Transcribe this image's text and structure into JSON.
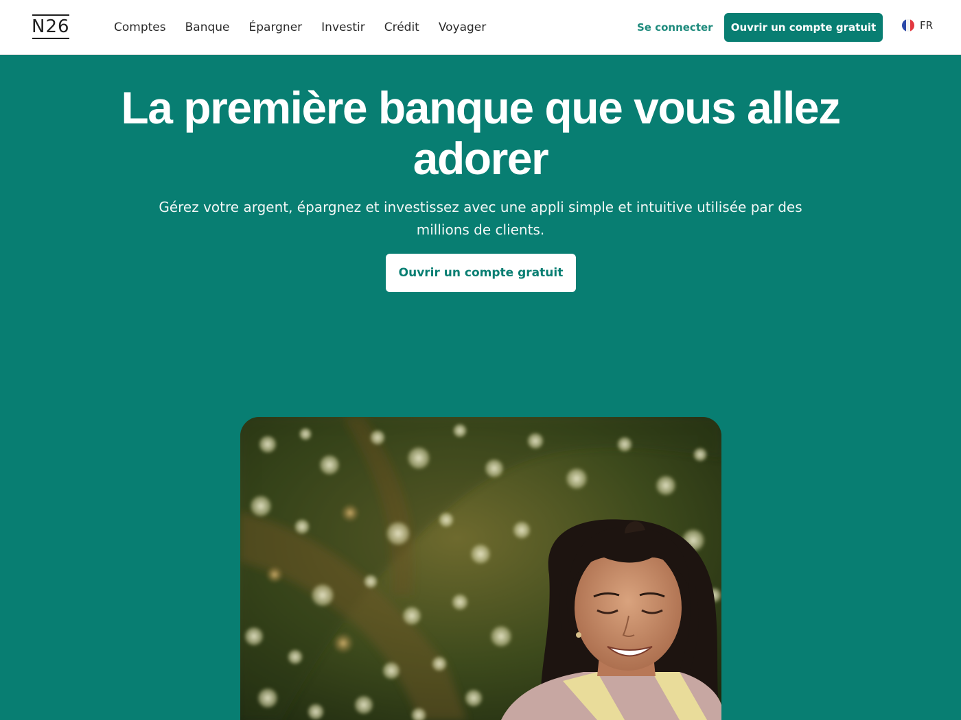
{
  "header": {
    "logo_text": "N26",
    "nav": [
      "Comptes",
      "Banque",
      "Épargner",
      "Investir",
      "Crédit",
      "Voyager"
    ],
    "login_label": "Se connecter",
    "cta_label": "Ouvrir un compte gratuit",
    "language": "FR",
    "flag_icon": "france-flag-icon"
  },
  "hero": {
    "title": "La première banque que vous allez adorer",
    "subtitle": "Gérez votre argent, épargnez et investissez avec une appli simple et intuitive utilisée par des millions de clients.",
    "cta_label": "Ouvrir un compte gratuit"
  },
  "colors": {
    "brand_teal": "#087e72",
    "link_teal": "#1f8b7d",
    "white": "#ffffff"
  }
}
